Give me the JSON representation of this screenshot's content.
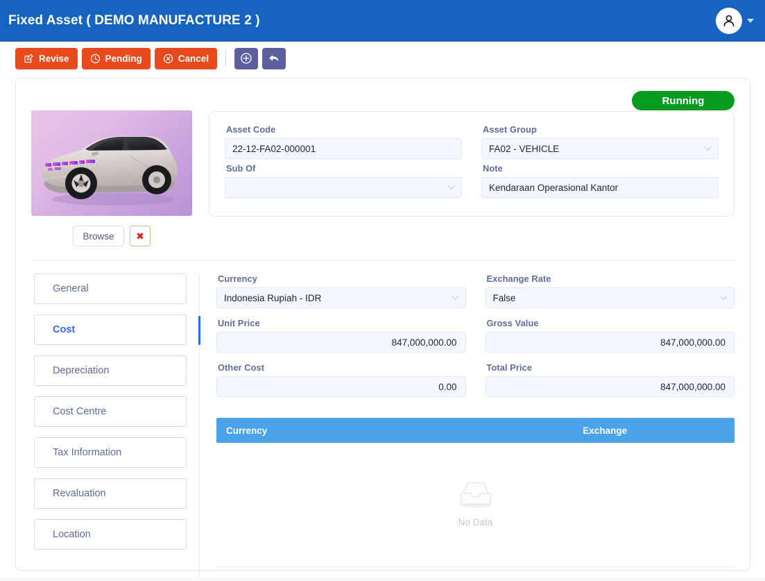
{
  "header": {
    "title": "Fixed Asset ( DEMO MANUFACTURE 2 )",
    "avatar_icon": "user-icon",
    "caret_icon": "chevron-down-icon"
  },
  "toolbar": {
    "buttons": [
      {
        "label": "Revise",
        "icon": "edit-square-icon",
        "color": "#e8491d"
      },
      {
        "label": "Pending",
        "icon": "clock-icon",
        "color": "#e8491d"
      },
      {
        "label": "Cancel",
        "icon": "circle-x-icon",
        "color": "#e8491d"
      }
    ],
    "icon_buttons": [
      {
        "label": "",
        "icon": "circle-plus-icon",
        "color": "#5c5f9e"
      },
      {
        "label": "",
        "icon": "back-arrow-icon",
        "color": "#5c5f9e"
      }
    ]
  },
  "status": {
    "badge_label": "Running",
    "badge_color": "#079b1f"
  },
  "photo": {
    "alt": "vehicle-photo",
    "browse_label": "Browse",
    "remove_label": "✖"
  },
  "asset_info": {
    "asset_code": {
      "label": "Asset Code",
      "value": "22-12-FA02-000001"
    },
    "asset_group": {
      "label": "Asset Group",
      "value": "FA02 - VEHICLE"
    },
    "sub_of": {
      "label": "Sub Of",
      "value": ""
    },
    "note": {
      "label": "Note",
      "value": "Kendaraan Operasional Kantor"
    }
  },
  "tabs": [
    {
      "label": "General",
      "active": false
    },
    {
      "label": "Cost",
      "active": true
    },
    {
      "label": "Depreciation",
      "active": false
    },
    {
      "label": "Cost Centre",
      "active": false
    },
    {
      "label": "Tax Information",
      "active": false
    },
    {
      "label": "Revaluation",
      "active": false
    },
    {
      "label": "Location",
      "active": false
    }
  ],
  "cost_form": {
    "currency": {
      "label": "Currency",
      "value": "Indonesia Rupiah - IDR"
    },
    "exchange_rate": {
      "label": "Exchange Rate",
      "value": "False"
    },
    "unit_price": {
      "label": "Unit Price",
      "value": "847,000,000.00"
    },
    "gross_value": {
      "label": "Gross Value",
      "value": "847,000,000.00"
    },
    "other_cost": {
      "label": "Other Cost",
      "value": "0.00"
    },
    "total_price": {
      "label": "Total Price",
      "value": "847,000,000.00"
    }
  },
  "exchange_table": {
    "columns": [
      "Currency",
      "Exchange"
    ],
    "rows": [],
    "empty_label": "No Data",
    "empty_icon": "inbox-icon",
    "header_color": "#4aa3e8"
  },
  "colors": {
    "header_blue": "#1663c0",
    "accent_blue": "#2f6bef",
    "orange": "#e8491d",
    "purple": "#5c5f9e",
    "green": "#079b1f",
    "table_header": "#4aa3e8",
    "label_text": "#5e6b9e",
    "input_bg": "#f4f7fd"
  }
}
